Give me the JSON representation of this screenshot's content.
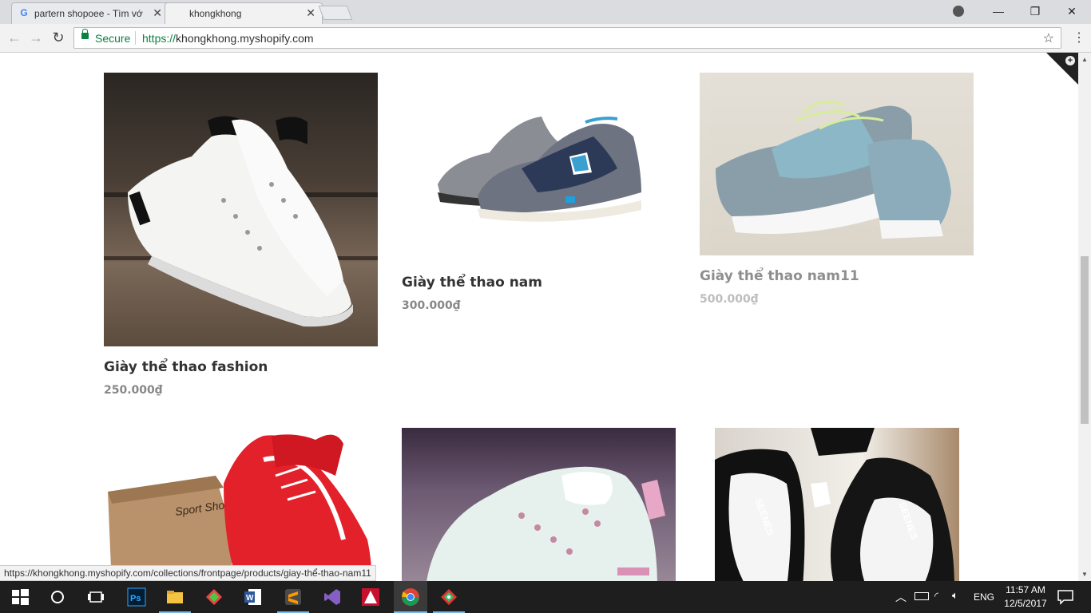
{
  "browser": {
    "tabs": [
      {
        "title": "partern shopoee - Tìm vớ",
        "icon": "google-icon"
      },
      {
        "title": "khongkhong",
        "icon": "none"
      }
    ],
    "secure_label": "Secure",
    "url_scheme": "https://",
    "url_host": "khongkhong.myshopify.com",
    "status_url": "https://khongkhong.myshopify.com/collections/frontpage/products/giay-thể-thao-nam11"
  },
  "products": [
    {
      "title": "Giày thể thao fashion",
      "price": "250.000₫"
    },
    {
      "title": "Giày thể thao nam",
      "price": "300.000₫"
    },
    {
      "title": "Giày thể thao nam11",
      "price": "500.000₫"
    },
    {
      "image": "red-sneakers-with-box"
    },
    {
      "image": "white-pink-sneakers"
    },
    {
      "image": "black-white-sneakers"
    }
  ],
  "taskbar": {
    "language": "ENG",
    "time": "11:57 AM",
    "date": "12/5/2017",
    "apps": [
      "windows-start-icon",
      "cortana-icon",
      "task-view-icon",
      "photoshop-icon",
      "file-explorer-icon",
      "sketchup-icon",
      "word-icon",
      "sublime-icon",
      "visual-studio-icon",
      "autocad-icon",
      "chrome-icon",
      "gitkraken-icon"
    ]
  }
}
